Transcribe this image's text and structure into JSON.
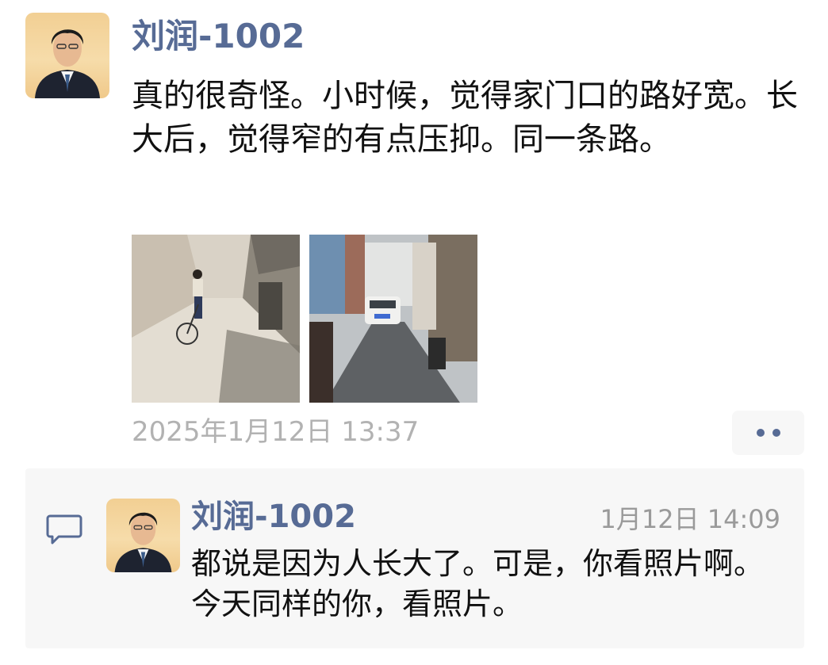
{
  "post": {
    "author": "刘润-1002",
    "text": "真的很奇怪。小时候，觉得家门口的路好宽。长大后，觉得窄的有点压抑。同一条路。",
    "time": "2025年1月12日 13:37",
    "avatar_icon": "portrait-avatar",
    "images": [
      {
        "name": "childhood-alley-photo",
        "description_icon": "photo-thumbnail"
      },
      {
        "name": "present-alley-photo",
        "description_icon": "photo-thumbnail"
      }
    ],
    "more_icon": "ellipsis-icon"
  },
  "comment": {
    "icon": "comment-bubble-icon",
    "author": "刘润-1002",
    "time": "1月12日 14:09",
    "text": "都说是因为人长大了。可是，你看照片啊。今天同样的你，看照片。"
  },
  "colors": {
    "link_blue": "#576b95",
    "meta_gray": "#b2b2b2",
    "panel_bg": "#f7f7f7"
  }
}
